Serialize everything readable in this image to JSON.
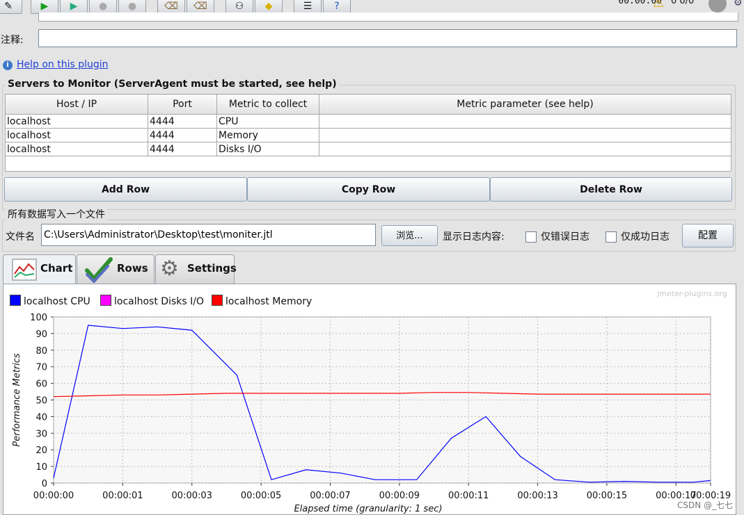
{
  "comment": {
    "label": "注释:",
    "value": ""
  },
  "timer": "00:00:00",
  "status_counter": "0 0/0",
  "help_link": "Help on this plugin",
  "servers": {
    "title": "Servers to Monitor (ServerAgent must be started, see help)",
    "columns": [
      "Host / IP",
      "Port",
      "Metric to collect",
      "Metric parameter (see help)"
    ],
    "rows": [
      [
        "localhost",
        "4444",
        "CPU",
        ""
      ],
      [
        "localhost",
        "4444",
        "Memory",
        ""
      ],
      [
        "localhost",
        "4444",
        "Disks I/O",
        ""
      ]
    ],
    "add_row": "Add Row",
    "copy_row": "Copy Row",
    "delete_row": "Delete Row"
  },
  "file_section": {
    "title": "所有数据写入一个文件",
    "filename_label": "文件名",
    "filename_value": "C:\\Users\\Administrator\\Desktop\\test\\moniter.jtl",
    "browse": "浏览...",
    "log_content_label": "显示日志内容:",
    "errors_only": "仅错误日志",
    "success_only": "仅成功日志",
    "configure": "配置"
  },
  "tabs": [
    {
      "label": "Chart",
      "icon": "chart-icon",
      "active": true
    },
    {
      "label": "Rows",
      "icon": "checkmark-icon",
      "active": false
    },
    {
      "label": "Settings",
      "icon": "gear-icon",
      "active": false
    }
  ],
  "watermark": "jmeter-plugins.org",
  "csdn_mark": "CSDN @_七七",
  "colors": {
    "cpu": "#0000ff",
    "disks": "#ff00ff",
    "memory": "#ff0000"
  },
  "chart_data": {
    "type": "line",
    "ylabel": "Performance Metrics",
    "xlabel": "Elapsed time (granularity: 1 sec)",
    "ylim": [
      0,
      100
    ],
    "yticks": [
      0,
      10,
      20,
      30,
      40,
      50,
      60,
      70,
      80,
      90,
      100
    ],
    "xlim": [
      0,
      19
    ],
    "xticks": [
      {
        "v": 0,
        "label": "00:00:00"
      },
      {
        "v": 2,
        "label": "00:00:01"
      },
      {
        "v": 4,
        "label": "00:00:03"
      },
      {
        "v": 6,
        "label": "00:00:05"
      },
      {
        "v": 8,
        "label": "00:00:07"
      },
      {
        "v": 10,
        "label": "00:00:09"
      },
      {
        "v": 12,
        "label": "00:00:11"
      },
      {
        "v": 14,
        "label": "00:00:13"
      },
      {
        "v": 16,
        "label": "00:00:15"
      },
      {
        "v": 18,
        "label": "00:00:17"
      },
      {
        "v": 19,
        "label": "00:00:19"
      }
    ],
    "grid": true,
    "legend": "top-left",
    "series": [
      {
        "name": "localhost CPU",
        "color": "#0000ff",
        "points": [
          [
            0,
            3
          ],
          [
            1,
            95
          ],
          [
            2,
            93
          ],
          [
            3,
            94
          ],
          [
            4,
            92
          ],
          [
            5.3,
            65
          ],
          [
            6.3,
            2
          ],
          [
            7.3,
            8
          ],
          [
            8.3,
            6
          ],
          [
            9.3,
            2
          ],
          [
            10.5,
            2
          ],
          [
            11.5,
            27
          ],
          [
            12.5,
            40
          ],
          [
            13.5,
            16
          ],
          [
            14.5,
            2
          ],
          [
            15.5,
            0.5
          ],
          [
            16.5,
            1
          ],
          [
            17.5,
            0.5
          ],
          [
            18.5,
            0.5
          ],
          [
            19,
            1.5
          ]
        ]
      },
      {
        "name": "localhost Disks I/O",
        "color": "#ff00ff",
        "points": []
      },
      {
        "name": "localhost Memory",
        "color": "#ff0000",
        "points": [
          [
            0,
            52
          ],
          [
            1,
            52.5
          ],
          [
            2,
            53
          ],
          [
            3,
            53
          ],
          [
            4,
            53.5
          ],
          [
            5,
            54
          ],
          [
            6,
            54
          ],
          [
            7,
            54
          ],
          [
            8,
            54
          ],
          [
            9,
            54
          ],
          [
            10,
            54
          ],
          [
            11,
            54.5
          ],
          [
            12,
            54.5
          ],
          [
            13,
            54
          ],
          [
            14,
            53.5
          ],
          [
            15,
            53.5
          ],
          [
            16,
            53.5
          ],
          [
            17,
            53.5
          ],
          [
            18,
            53.5
          ],
          [
            19,
            53.5
          ]
        ]
      }
    ]
  }
}
